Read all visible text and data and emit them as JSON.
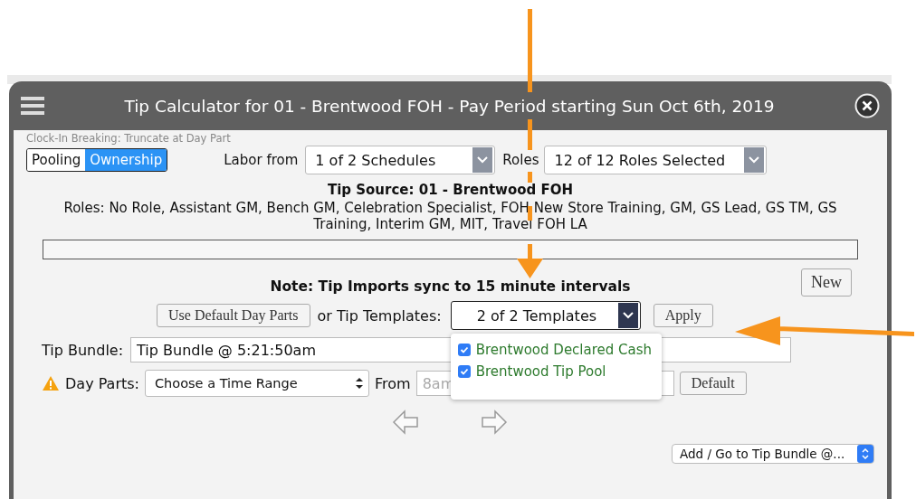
{
  "window": {
    "title": "Tip Calculator for 01 - Brentwood FOH - Pay Period starting Sun Oct 6th, 2019"
  },
  "clock_in_note": "Clock-In Breaking: Truncate at Day Part",
  "mode_toggle": [
    {
      "label": "Pooling",
      "selected": false
    },
    {
      "label": "Ownership",
      "selected": true
    }
  ],
  "labor": {
    "label": "Labor from",
    "value": "1 of 2 Schedules"
  },
  "roles_filter": {
    "label": "Roles",
    "value": "12 of 12 Roles Selected"
  },
  "tip_source": "Tip Source: 01 - Brentwood FOH",
  "roles_list": "Roles: No Role, Assistant GM, Bench GM, Celebration Specialist, FOH New Store Training, GM, GS Lead, GS TM, GS Training, Interim GM, MIT, Travel FOH LA",
  "note": "Note: Tip Imports sync to 15 minute intervals",
  "new_button": "New",
  "default_day_parts_button": "Use Default Day Parts",
  "templates": {
    "label": "or Tip Templates:",
    "value": "2 of 2 Templates",
    "expanded": true,
    "options": [
      {
        "label": "Brentwood Declared Cash",
        "checked": true
      },
      {
        "label": "Brentwood Tip Pool",
        "checked": true
      }
    ]
  },
  "apply_button": "Apply",
  "tip_bundle": {
    "label": "Tip Bundle:",
    "value": "Tip Bundle @ 5:21:50am"
  },
  "day_parts": {
    "label": "Day Parts:",
    "value": "Choose a Time Range",
    "from_label": "From",
    "from_placeholder": "8am",
    "default_button": "Default"
  },
  "bundle_select": "Add / Go to Tip Bundle @..."
}
